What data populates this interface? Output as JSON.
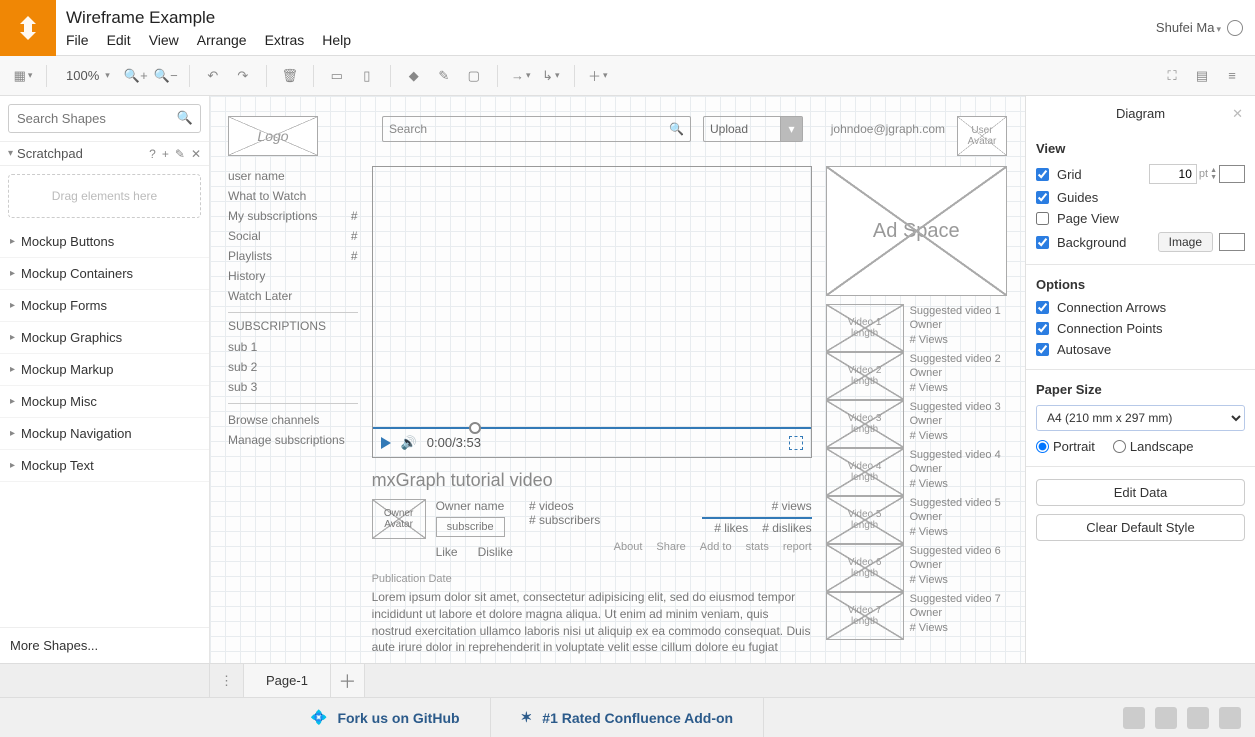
{
  "header": {
    "doc_title": "Wireframe Example",
    "menus": [
      "File",
      "Edit",
      "View",
      "Arrange",
      "Extras",
      "Help"
    ],
    "user_name": "Shufei Ma"
  },
  "toolbar": {
    "zoom": "100%"
  },
  "left_panel": {
    "search_placeholder": "Search Shapes",
    "scratchpad_label": "Scratchpad",
    "scratchpad_drop": "Drag elements here",
    "categories": [
      "Mockup Buttons",
      "Mockup Containers",
      "Mockup Forms",
      "Mockup Graphics",
      "Mockup Markup",
      "Mockup Misc",
      "Mockup Navigation",
      "Mockup Text"
    ],
    "more_shapes": "More Shapes..."
  },
  "wireframe": {
    "logo": "Logo",
    "search_label": "Search",
    "upload_label": "Upload",
    "email": "johndoe@jgraph.com",
    "avatar_label": "User\nAvatar",
    "sidebar": {
      "items": [
        {
          "label": "user name"
        },
        {
          "label": "What to Watch"
        },
        {
          "label": "My subscriptions",
          "badge": "#"
        },
        {
          "label": "Social",
          "badge": "#"
        },
        {
          "label": "Playlists",
          "badge": "#"
        },
        {
          "label": "History"
        },
        {
          "label": "Watch Later"
        }
      ],
      "subs_header": "SUBSCRIPTIONS",
      "subs": [
        "sub 1",
        "sub 2",
        "sub 3"
      ],
      "extra": [
        "Browse channels",
        "Manage subscriptions"
      ]
    },
    "player_time": "0:00/3:53",
    "video_title": "mxGraph tutorial video",
    "owner": {
      "avatar": "Owner\nAvatar",
      "name": "Owner name",
      "subscribe": "subscribe"
    },
    "stats": {
      "videos": "# videos",
      "subscribers": "# subscribers",
      "views": "# views",
      "likes": "# likes",
      "dislikes": "# dislikes"
    },
    "likebar": {
      "like": "Like",
      "dislike": "Dislike"
    },
    "actions": [
      "About",
      "Share",
      "Add to",
      "stats",
      "report"
    ],
    "pub_label": "Publication Date",
    "lorem": "Lorem ipsum dolor sit amet, consectetur adipisicing elit, sed do eiusmod tempor incididunt ut labore et dolore magna aliqua. Ut enim ad minim veniam, quis nostrud exercitation ullamco laboris nisi ut aliquip ex ea commodo consequat. Duis aute irure dolor in reprehenderit in voluptate velit esse cillum dolore eu fugiat",
    "ad": "Ad Space",
    "suggested": [
      {
        "thumb": "Video 1\nlength",
        "title": "Suggested video 1",
        "owner": "Owner",
        "views": "# Views"
      },
      {
        "thumb": "Video 2\nlength",
        "title": "Suggested video 2",
        "owner": "Owner",
        "views": "# Views"
      },
      {
        "thumb": "Video 3\nlength",
        "title": "Suggested video 3",
        "owner": "Owner",
        "views": "# Views"
      },
      {
        "thumb": "Video 4\nlength",
        "title": "Suggested video 4",
        "owner": "Owner",
        "views": "# Views"
      },
      {
        "thumb": "Video 5\nlength",
        "title": "Suggested video 5",
        "owner": "Owner",
        "views": "# Views"
      },
      {
        "thumb": "Video 6\nlength",
        "title": "Suggested video 6",
        "owner": "Owner",
        "views": "# Views"
      },
      {
        "thumb": "Video 7\nlength",
        "title": "Suggested video 7",
        "owner": "Owner",
        "views": "# Views"
      }
    ]
  },
  "right_panel": {
    "title": "Diagram",
    "view_label": "View",
    "grid": "Grid",
    "grid_size": "10",
    "grid_unit": "pt",
    "guides": "Guides",
    "page_view": "Page View",
    "background": "Background",
    "image_btn": "Image",
    "options_label": "Options",
    "conn_arrows": "Connection Arrows",
    "conn_points": "Connection Points",
    "autosave": "Autosave",
    "paper_label": "Paper Size",
    "paper_value": "A4 (210 mm x 297 mm)",
    "portrait": "Portrait",
    "landscape": "Landscape",
    "edit_data": "Edit Data",
    "clear_style": "Clear Default Style"
  },
  "tabs": {
    "page1": "Page-1"
  },
  "footer": {
    "fork": "Fork us on GitHub",
    "confluence": "#1 Rated Confluence Add-on"
  }
}
